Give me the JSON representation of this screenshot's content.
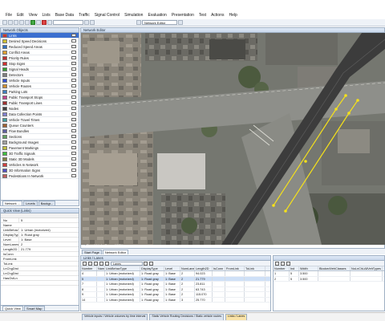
{
  "menu": [
    "File",
    "Edit",
    "View",
    "Lists",
    "Base Data",
    "Traffic",
    "Signal Control",
    "Simulation",
    "Evaluation",
    "Presentation",
    "Test",
    "Actions",
    "Help"
  ],
  "toolbar": {
    "input_value": "",
    "network_editor_input": "Network Editor"
  },
  "network_objects": {
    "title": "Network Objects",
    "items": [
      {
        "label": "Links",
        "sel": true,
        "color": "#cc3333"
      },
      {
        "label": "Desired Speed Decisions",
        "color": "#d0c030"
      },
      {
        "label": "Reduced Speed Areas",
        "color": "#3070c0"
      },
      {
        "label": "Conflict Areas",
        "color": "#e0a030"
      },
      {
        "label": "Priority Rules",
        "color": "#c03030"
      },
      {
        "label": "Stop Signs",
        "color": "#d03030"
      },
      {
        "label": "Signal Heads",
        "color": "#30a030"
      },
      {
        "label": "Detectors",
        "color": "#808080"
      },
      {
        "label": "Vehicle Inputs",
        "color": "#3050d0"
      },
      {
        "label": "Vehicle Routes",
        "color": "#d09030"
      },
      {
        "label": "Parking Lots",
        "color": "#4080c0"
      },
      {
        "label": "Public Transport Stops",
        "color": "#c04090"
      },
      {
        "label": "Public Transport Lines",
        "color": "#a03030"
      },
      {
        "label": "Nodes",
        "color": "#404040"
      },
      {
        "label": "Data Collection Points",
        "color": "#8080d0"
      },
      {
        "label": "Vehicle Travel Times",
        "color": "#40a0a0"
      },
      {
        "label": "Queue Counters",
        "color": "#a06030"
      },
      {
        "label": "Flow Bundles",
        "color": "#6060a0"
      },
      {
        "label": "Sections",
        "color": "#60a060"
      },
      {
        "label": "Background Images",
        "color": "#a0a0a0"
      },
      {
        "label": "Pavement Markings",
        "color": "#c0c040"
      },
      {
        "label": "3D Traffic Signals",
        "color": "#40c040"
      },
      {
        "label": "Static 3D Models",
        "color": "#808040"
      },
      {
        "label": "Vehicles In Network",
        "color": "#d04040"
      },
      {
        "label": "3D Information Signs",
        "color": "#5050c0"
      },
      {
        "label": "Pedestrians In Network",
        "color": "#c06060"
      }
    ],
    "tabs": [
      "Network ...",
      "Levels",
      "Backgr..."
    ]
  },
  "quick_view": {
    "title": "Quick View (Links)",
    "rows": [
      {
        "k": "No",
        "v": "5"
      },
      {
        "k": "Name",
        "v": ""
      },
      {
        "k": "LinkBehavType",
        "v": "1: Urban (motorized)"
      },
      {
        "k": "DisplayType",
        "v": "1: Road gray"
      },
      {
        "k": "Level",
        "v": "1: Base"
      },
      {
        "k": "NumLanes",
        "v": "2"
      },
      {
        "k": "Length2D",
        "v": "21.779"
      },
      {
        "k": "IsConn",
        "v": ""
      },
      {
        "k": "FromLink",
        "v": ""
      },
      {
        "k": "ToLink",
        "v": ""
      },
      {
        "k": "LnChgDistDistrDef",
        "v": ""
      },
      {
        "k": "LnChgDistIsPerLane",
        "v": ""
      },
      {
        "k": "HasOvtLn",
        "v": ""
      },
      {
        "k": "",
        "v": ""
      }
    ],
    "tabs": [
      "Quick View",
      "Smart Map"
    ]
  },
  "network_editor": {
    "title": "Network Editor",
    "status": "Pos: 194.4 ; Zoom: 100%",
    "tabs": [
      "Start Page",
      "Network Editor"
    ]
  },
  "links_list": {
    "title": "Links / Lanes",
    "select_value": "Lanes",
    "headers": [
      "Number",
      "Name",
      "LinkBehavType",
      "DisplayType",
      "Level",
      "NumLanes",
      "Length2D",
      "IsConn",
      "FromLink",
      "ToLink"
    ],
    "rows": [
      [
        "4",
        "",
        "1: Urban (motorized)",
        "1: Road gray",
        "1: Base",
        "2",
        "94.023",
        "",
        "",
        ""
      ],
      [
        "5",
        "",
        "1: Urban (motorized)",
        "1: Road gray",
        "1: Base",
        "2",
        "21.779",
        "",
        "",
        ""
      ],
      [
        "7",
        "",
        "1: Urban (motorized)",
        "1: Road gray",
        "1: Base",
        "2",
        "23.811",
        "",
        "",
        ""
      ],
      [
        "8",
        "",
        "1: Urban (motorized)",
        "1: Road gray",
        "1: Base",
        "2",
        "63.743",
        "",
        "",
        ""
      ],
      [
        "9",
        "",
        "1: Urban (motorized)",
        "1: Road gray",
        "1: Base",
        "2",
        "115.070",
        "",
        "",
        ""
      ],
      [
        "14",
        "",
        "1: Urban (motorized)",
        "1: Road gray",
        "1: Base",
        "3",
        "25.770",
        "",
        "",
        ""
      ]
    ],
    "tabs": [
      "Vehicle inputs / Vehicle volumes by time interval",
      "Static Vehicle Routing Decisions / Static vehicle routes",
      "Links / Lanes"
    ]
  },
  "lanes_list": {
    "headers": [
      "Number",
      "Ind",
      "Width",
      "BlockedVehClasses",
      "NoLnChLAllVehTypes"
    ],
    "rows": [
      [
        "1",
        "5",
        "3.500",
        "",
        ""
      ],
      [
        "2",
        "5",
        "3.500",
        "",
        ""
      ]
    ]
  },
  "colors": {
    "accent": "#3a6fd0",
    "road": "#3c3c3c",
    "selection": "#f5e11a",
    "panel_border": "#9fb0c4"
  }
}
